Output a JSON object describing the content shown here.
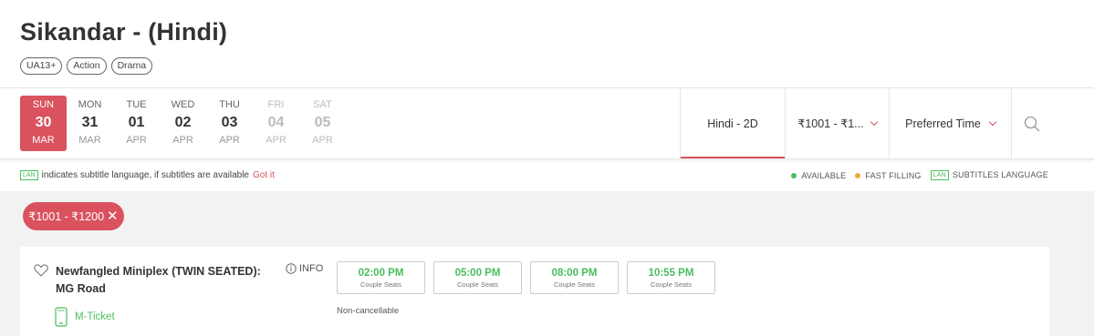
{
  "movie": {
    "title": "Sikandar - (Hindi)",
    "tags": [
      "UA13+",
      "Action",
      "Drama"
    ]
  },
  "dates": [
    {
      "dow": "SUN",
      "day": "30",
      "mon": "MAR",
      "state": "selected"
    },
    {
      "dow": "MON",
      "day": "31",
      "mon": "MAR",
      "state": "available"
    },
    {
      "dow": "TUE",
      "day": "01",
      "mon": "APR",
      "state": "available"
    },
    {
      "dow": "WED",
      "day": "02",
      "mon": "APR",
      "state": "available"
    },
    {
      "dow": "THU",
      "day": "03",
      "mon": "APR",
      "state": "available"
    },
    {
      "dow": "FRI",
      "day": "04",
      "mon": "APR",
      "state": "disabled"
    },
    {
      "dow": "SAT",
      "day": "05",
      "mon": "APR",
      "state": "disabled"
    }
  ],
  "filters": {
    "format": "Hindi - 2D",
    "price": "₹1001 - ₹1...",
    "time": "Preferred Time"
  },
  "info_bar": {
    "lan_badge": "LAN",
    "subtitle_note": "indicates subtitle language, if subtitles are available",
    "got_it": "Got it",
    "legend": {
      "available": "AVAILABLE",
      "fast_filling": "FAST FILLING",
      "subtitles": "SUBTITLES LANGUAGE"
    }
  },
  "colors": {
    "accent": "#d9525e",
    "available": "#4abd5d",
    "fast_filling": "#f0a93a"
  },
  "active_filter_chip": "₹1001 - ₹1200",
  "cinema": {
    "name": "Newfangled Miniplex (TWIN SEATED): MG Road",
    "info_label": "INFO",
    "mticket": "M-Ticket",
    "note": "Non-cancellable",
    "showtimes": [
      {
        "time": "02:00 PM",
        "seat_type": "Couple Seats"
      },
      {
        "time": "05:00 PM",
        "seat_type": "Couple Seats"
      },
      {
        "time": "08:00 PM",
        "seat_type": "Couple Seats"
      },
      {
        "time": "10:55 PM",
        "seat_type": "Couple Seats"
      }
    ]
  }
}
